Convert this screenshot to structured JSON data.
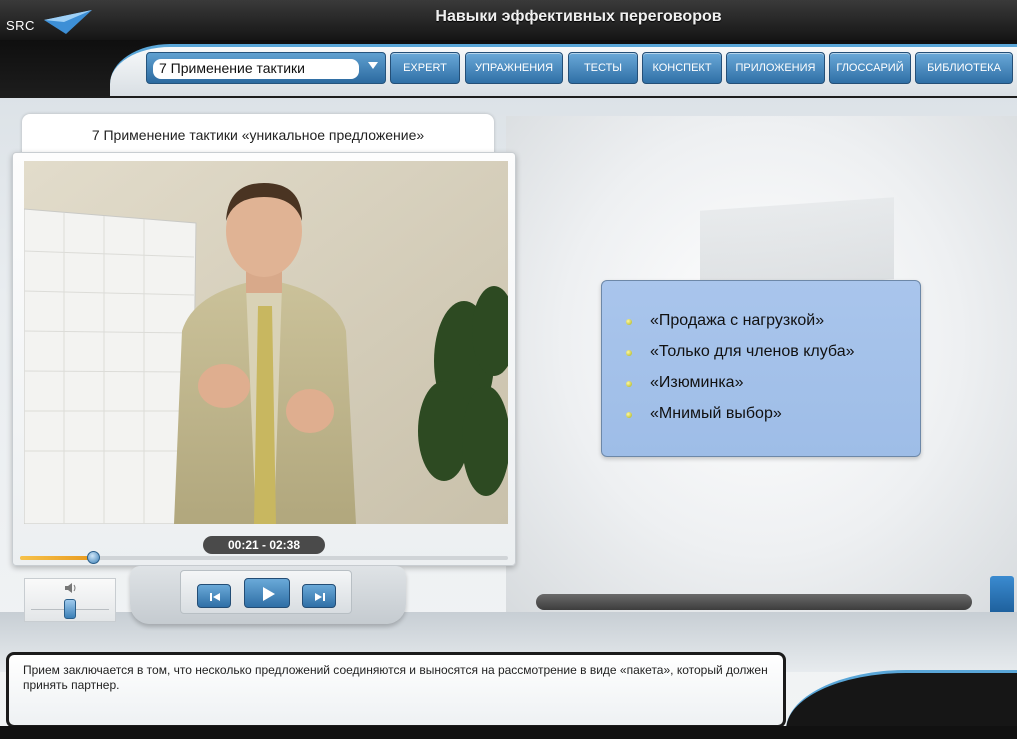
{
  "app": {
    "logo_text": "SRC",
    "title": "Навыки эффективных переговоров"
  },
  "nav": {
    "topic_select": "7 Применение тактики",
    "buttons": [
      "EXPERT",
      "УПРАЖНЕНИЯ",
      "ТЕСТЫ",
      "КОНСПЕКТ",
      "ПРИЛОЖЕНИЯ",
      "ГЛОССАРИЙ",
      "БИБЛИОТЕКА"
    ]
  },
  "video": {
    "title": "7 Применение тактики «уникальное предложение»",
    "timecode": "00:21 - 02:38",
    "progress_fraction": 0.15,
    "volume_level": 0.5
  },
  "slide": {
    "bullets": [
      "«Продажа с нагрузкой»",
      "«Только для членов клуба»",
      "«Изюминка»",
      "«Мнимый выбор»"
    ]
  },
  "description": "Прием заключается в том, что несколько предложений соединяются и выносятся на рассмотрение в виде «пакета», который должен принять партнер.",
  "colors": {
    "accent_blue": "#2f6fa6",
    "bullet_panel": "#a9c5ec",
    "seek_fill": "#e89a1e"
  },
  "icons": {
    "logo": "src-logo-icon",
    "volume": "speaker-icon",
    "prev": "skip-previous-icon",
    "play": "play-icon",
    "next": "skip-next-icon"
  }
}
